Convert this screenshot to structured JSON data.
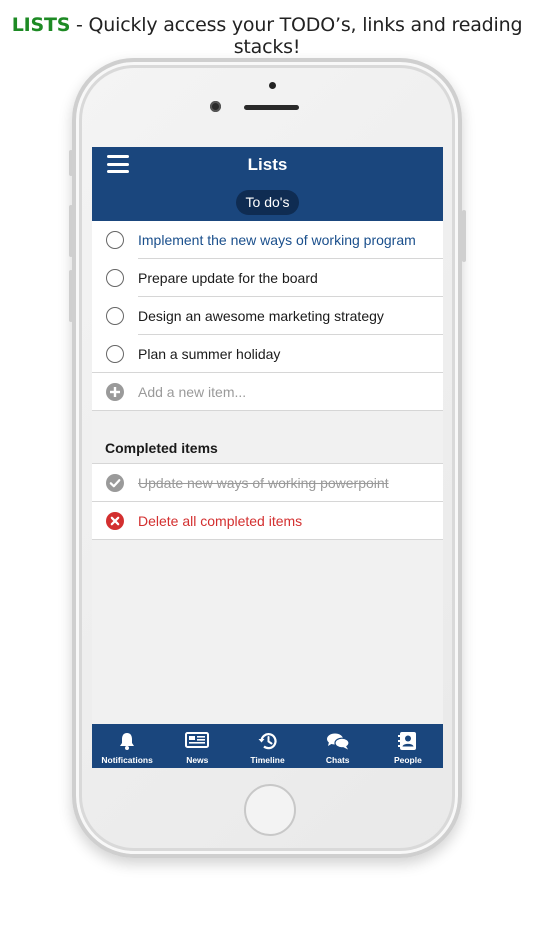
{
  "headline": {
    "brand": "LISTS",
    "rest": " - Quickly access your TODO’s, links and reading stacks!"
  },
  "app": {
    "title": "Lists",
    "filter_pill": "To do's"
  },
  "todos": [
    {
      "text": "Implement the new ways of working program",
      "highlighted": true
    },
    {
      "text": "Prepare update for the board",
      "highlighted": false
    },
    {
      "text": "Design an awesome marketing strategy",
      "highlighted": false
    },
    {
      "text": "Plan a summer holiday",
      "highlighted": false
    }
  ],
  "add_item": {
    "placeholder": "Add a new item..."
  },
  "completed": {
    "heading": "Completed items",
    "items": [
      {
        "text": "Update new ways of working powerpoint"
      }
    ],
    "delete_label": "Delete all completed items"
  },
  "tabs": [
    {
      "label": "Notifications",
      "icon": "bell-icon"
    },
    {
      "label": "News",
      "icon": "newspaper-icon"
    },
    {
      "label": "Timeline",
      "icon": "history-icon"
    },
    {
      "label": "Chats",
      "icon": "chat-bubbles-icon"
    },
    {
      "label": "People",
      "icon": "contacts-icon"
    }
  ],
  "colors": {
    "brand_green": "#1d8a24",
    "app_blue": "#1a467d",
    "pill_dark": "#0f2c52",
    "link_blue": "#1a4f8c",
    "delete_red": "#d32f2f",
    "muted_gray": "#9a9a9a"
  }
}
